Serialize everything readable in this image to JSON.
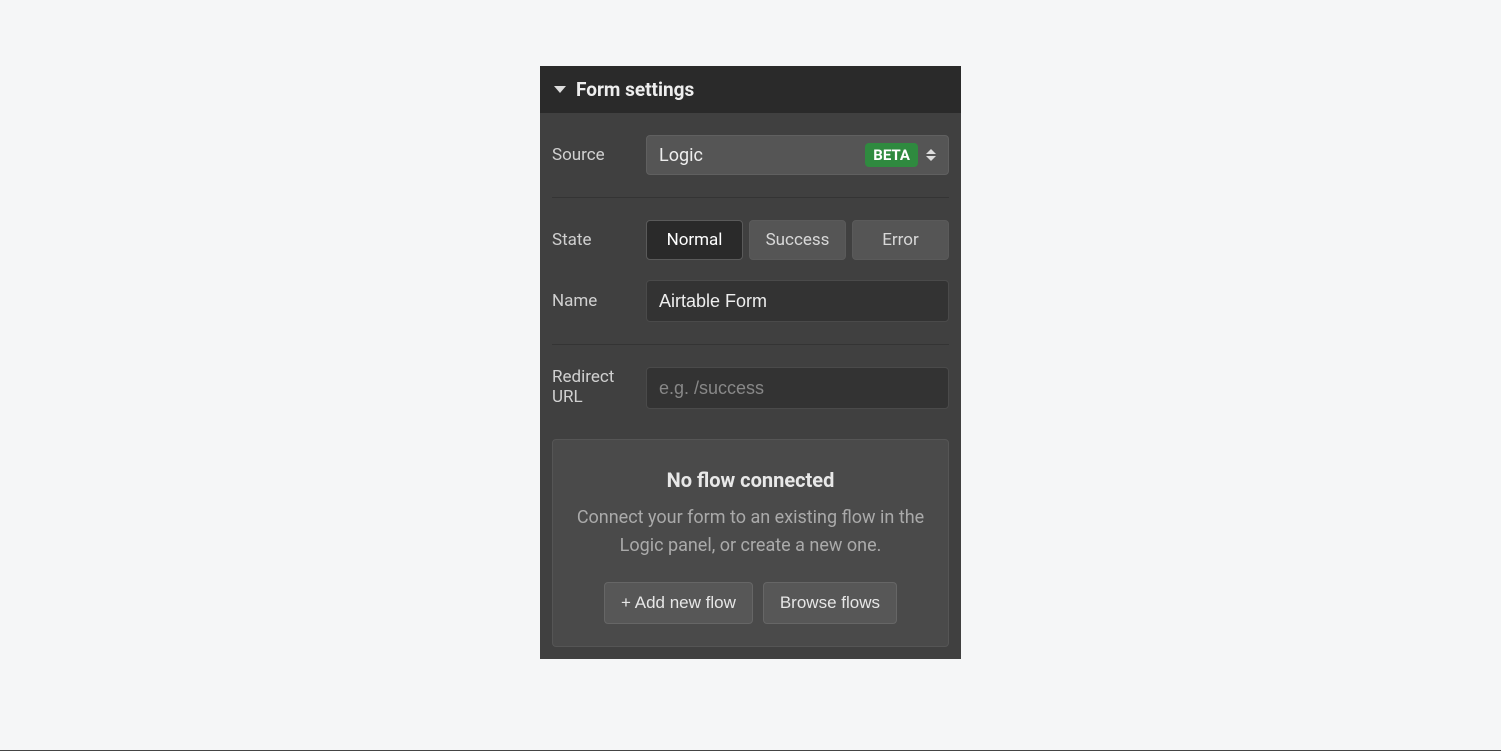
{
  "panel": {
    "title": "Form settings"
  },
  "source": {
    "label": "Source",
    "value": "Logic",
    "badge": "BETA"
  },
  "state": {
    "label": "State",
    "options": [
      "Normal",
      "Success",
      "Error"
    ],
    "active_index": 0
  },
  "name": {
    "label": "Name",
    "value": "Airtable Form"
  },
  "redirect": {
    "label": "Redirect URL",
    "placeholder": "e.g. /success",
    "value": ""
  },
  "flow": {
    "title": "No flow connected",
    "description": "Connect your form to an existing flow in the Logic panel, or create a new one.",
    "add_label": "+ Add new flow",
    "browse_label": "Browse flows"
  }
}
